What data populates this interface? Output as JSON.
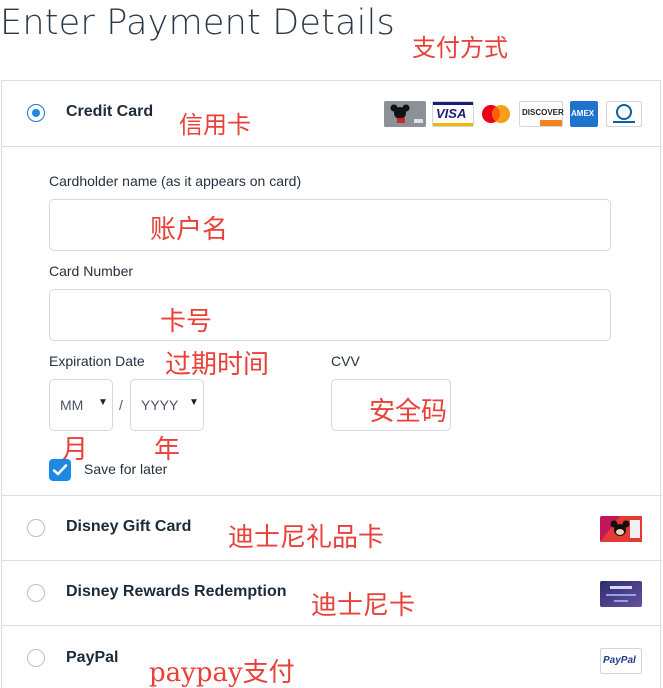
{
  "header": {
    "title": "Enter Payment Details",
    "title_note": "支付方式"
  },
  "credit_card": {
    "label": "Credit Card",
    "note": "信用卡",
    "selected": true,
    "card_logos": [
      {
        "name": "disney-visa-card",
        "text": ""
      },
      {
        "name": "visa",
        "text": "VISA"
      },
      {
        "name": "mastercard",
        "text": ""
      },
      {
        "name": "discover",
        "text": "DISCOVER"
      },
      {
        "name": "american-express",
        "text": "AMEX"
      },
      {
        "name": "diners-club",
        "text": ""
      }
    ],
    "cardholder": {
      "label": "Cardholder name (as it appears on card)",
      "value": "",
      "note": "账户名"
    },
    "card_number": {
      "label": "Card Number",
      "value": "",
      "note": "卡号"
    },
    "expiration": {
      "label": "Expiration Date",
      "note": "过期时间",
      "month": {
        "value": "MM",
        "note": "月"
      },
      "separator": "/",
      "year": {
        "value": "YYYY",
        "note": "年"
      }
    },
    "cvv": {
      "label": "CVV",
      "value": "",
      "note": "安全码"
    },
    "save_for_later": {
      "label": "Save for later",
      "checked": true
    }
  },
  "gift_card": {
    "label": "Disney Gift Card",
    "note": "迪士尼礼品卡",
    "selected": false
  },
  "rewards": {
    "label": "Disney Rewards Redemption",
    "note": "迪士尼卡",
    "selected": false
  },
  "paypal": {
    "label": "PayPal",
    "note": "paypay支付",
    "logo_text": "PayPal",
    "selected": false
  },
  "colors": {
    "accent": "#1e88e5",
    "annotation": "#e8413a",
    "border": "#d8dde3"
  }
}
